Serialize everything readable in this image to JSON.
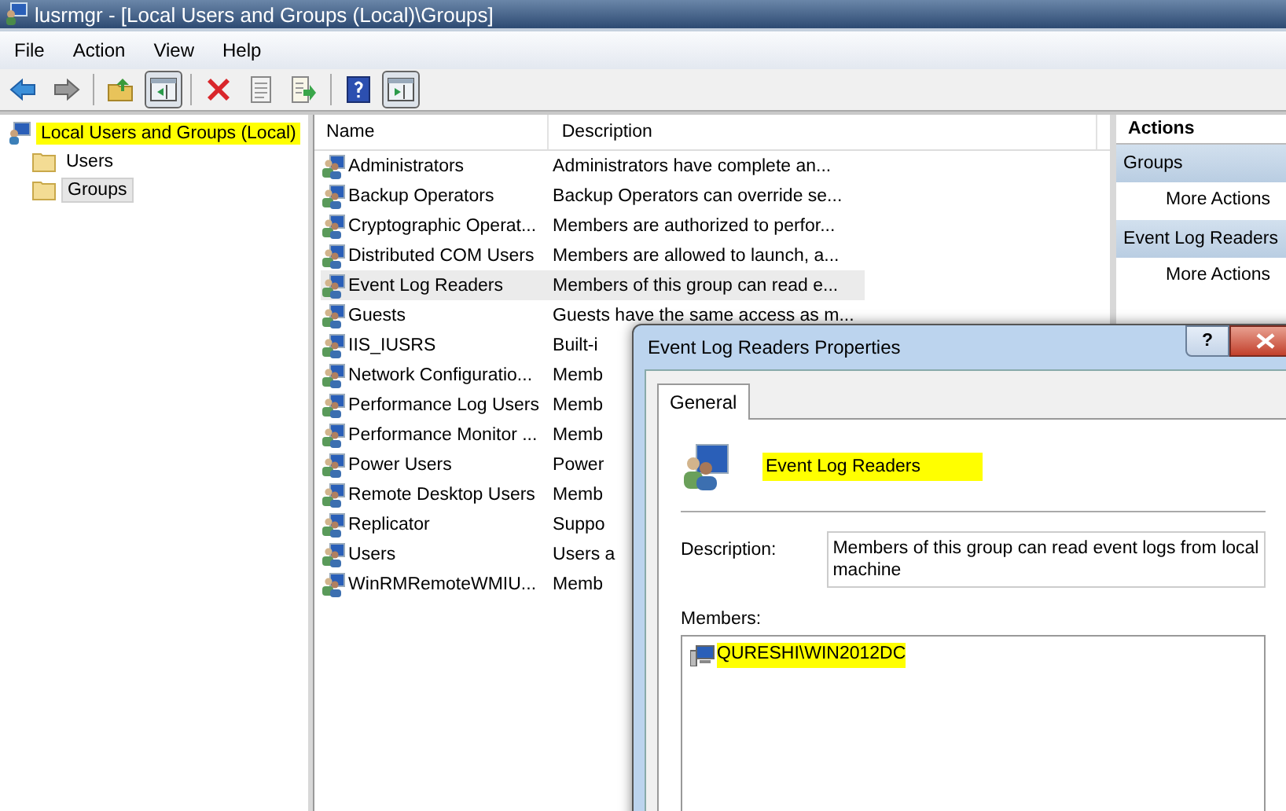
{
  "window": {
    "title": "lusrmgr - [Local Users and Groups (Local)\\Groups]"
  },
  "menu": [
    "File",
    "Action",
    "View",
    "Help"
  ],
  "toolbar": [
    {
      "kind": "back"
    },
    {
      "kind": "forward"
    },
    {
      "kind": "sep"
    },
    {
      "kind": "up"
    },
    {
      "kind": "tree",
      "selected": true
    },
    {
      "kind": "sep"
    },
    {
      "kind": "delete"
    },
    {
      "kind": "properties"
    },
    {
      "kind": "export"
    },
    {
      "kind": "sep"
    },
    {
      "kind": "help"
    },
    {
      "kind": "pane",
      "selected": true
    }
  ],
  "tree": {
    "label": "Local Users and Groups (Local)",
    "highlighted": true,
    "children": [
      {
        "label": "Users",
        "selected": false
      },
      {
        "label": "Groups",
        "selected": true
      }
    ]
  },
  "table": {
    "columns": [
      "Name",
      "Description"
    ],
    "rows": [
      {
        "name": "Administrators",
        "description": "Administrators have complete an...",
        "selected": false
      },
      {
        "name": "Backup Operators",
        "description": "Backup Operators can override se...",
        "selected": false
      },
      {
        "name": "Cryptographic Operat...",
        "description": "Members are authorized to perfor...",
        "selected": false
      },
      {
        "name": "Distributed COM Users",
        "description": "Members are allowed to launch, a...",
        "selected": false
      },
      {
        "name": "Event Log Readers",
        "description": "Members of this group can read e...",
        "selected": true
      },
      {
        "name": "Guests",
        "description": "Guests have the same access as m...",
        "selected": false
      },
      {
        "name": "IIS_IUSRS",
        "description": "Built-i",
        "selected": false
      },
      {
        "name": "Network Configuratio...",
        "description": "Memb",
        "selected": false
      },
      {
        "name": "Performance Log Users",
        "description": "Memb",
        "selected": false
      },
      {
        "name": "Performance Monitor ...",
        "description": "Memb",
        "selected": false
      },
      {
        "name": "Power Users",
        "description": "Power",
        "selected": false
      },
      {
        "name": "Remote Desktop Users",
        "description": "Memb",
        "selected": false
      },
      {
        "name": "Replicator",
        "description": "Suppo",
        "selected": false
      },
      {
        "name": "Users",
        "description": "Users a",
        "selected": false
      },
      {
        "name": "WinRMRemoteWMIU...",
        "description": "Memb",
        "selected": false
      }
    ]
  },
  "actions": {
    "title": "Actions",
    "sections": [
      {
        "title": "Groups",
        "items": [
          "More Actions"
        ]
      },
      {
        "title": "Event Log Readers",
        "items": [
          "More Actions"
        ]
      }
    ]
  },
  "dialog": {
    "title": "Event Log Readers Properties",
    "help": "?",
    "tabs": [
      {
        "label": "General",
        "selected": true
      }
    ],
    "group_name": "Event Log Readers",
    "group_name_highlighted": true,
    "description_label": "Description:",
    "description": "Members of this group can read event logs from local machine",
    "members_label": "Members:",
    "members": [
      {
        "name": "QURESHI\\WIN2012DC",
        "highlighted": true
      }
    ]
  }
}
